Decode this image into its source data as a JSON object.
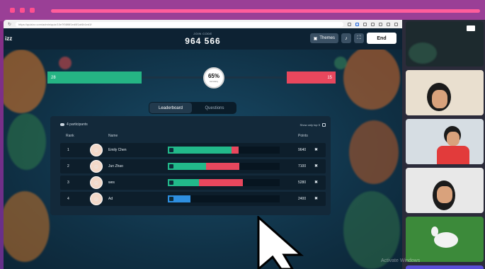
{
  "browser": {
    "url": "https://quizizz.com/admin/quiz/10e7f08f8f1ed0f1af4b1ed1f",
    "nav": {
      "refresh": "↻"
    }
  },
  "header": {
    "brand": "izz",
    "join_label": "JOIN CODE",
    "join_code": "964 566",
    "themes_label": "Themes",
    "end_label": "End"
  },
  "accuracy": {
    "correct_count": "28",
    "incorrect_count": "15",
    "percent": "65%",
    "percent_value": 65,
    "label": "Accuracy",
    "colors": {
      "correct": "#25b484",
      "incorrect": "#e8475d"
    }
  },
  "tabs": [
    {
      "label": "Leaderboard",
      "active": true
    },
    {
      "label": "Questions",
      "active": false
    }
  ],
  "leaderboard": {
    "participants_label": "4 participants",
    "show_top_label": "Show only top 5",
    "columns": {
      "rank": "Rank",
      "name": "Name",
      "points": "Points"
    },
    "rows": [
      {
        "rank": "1",
        "name": "Emily Chen",
        "points": "9640",
        "green": 0.57,
        "red": 0.06,
        "blue": 0
      },
      {
        "rank": "2",
        "name": "Jun Zhao",
        "points": "7100",
        "green": 0.34,
        "red": 0.3,
        "blue": 0
      },
      {
        "rank": "3",
        "name": "wes",
        "points": "5280",
        "green": 0.28,
        "red": 0.39,
        "blue": 0
      },
      {
        "rank": "4",
        "name": "Ad",
        "points": "2400",
        "green": 0,
        "red": 0,
        "blue": 0.2
      }
    ]
  },
  "side_panel": {
    "watermark": "Activate Windows"
  }
}
